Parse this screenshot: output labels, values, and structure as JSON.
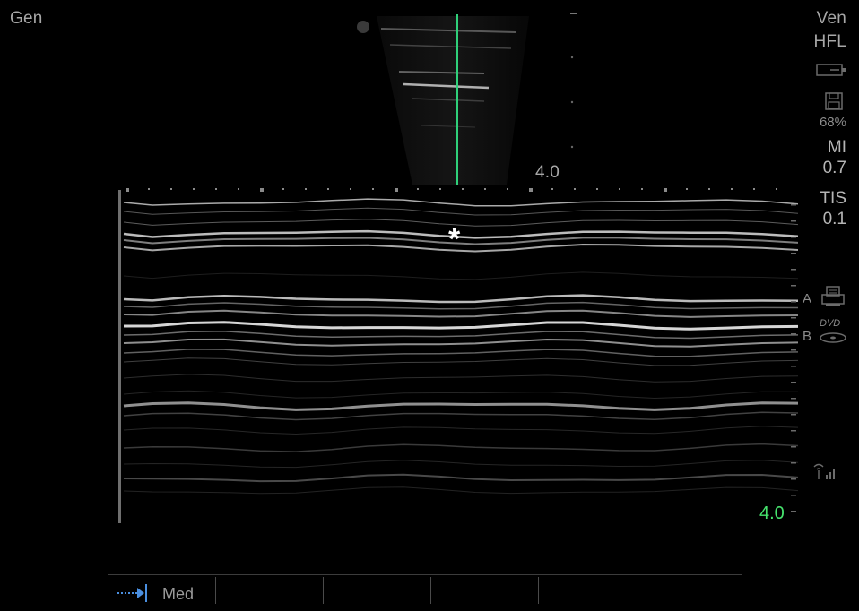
{
  "top_left": {
    "preset": "Gen"
  },
  "right_panel": {
    "exam": "Ven",
    "transducer": "HFL",
    "battery_pct": "68%",
    "mi_label": "MI",
    "mi_value": "0.7",
    "tis_label": "TIS",
    "tis_value": "0.1",
    "channel_a": "A",
    "channel_b": "B",
    "dvd_text": "DVD"
  },
  "bmode": {
    "depth": "4.0"
  },
  "mmode": {
    "depth": "4.0",
    "marker": "*"
  },
  "bottom": {
    "sweep_speed": "Med"
  },
  "colors": {
    "cursor_line": "#2fd07a",
    "depth_green": "#46e36d",
    "arrow_blue": "#4a8fe0"
  }
}
